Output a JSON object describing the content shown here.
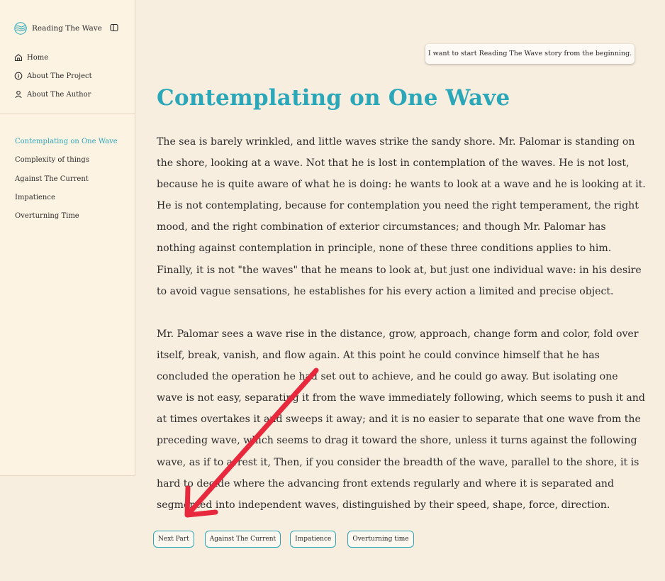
{
  "sidebar": {
    "brand": "Reading The Wave",
    "nav": [
      {
        "label": "Home",
        "icon": "home-icon"
      },
      {
        "label": "About The Project",
        "icon": "info-icon"
      },
      {
        "label": "About The Author",
        "icon": "user-icon"
      }
    ],
    "toc": [
      {
        "label": "Contemplating on One Wave",
        "active": true
      },
      {
        "label": "Complexity of things",
        "active": false
      },
      {
        "label": "Against The Current",
        "active": false
      },
      {
        "label": "Impatience",
        "active": false
      },
      {
        "label": "Overturning Time",
        "active": false
      }
    ]
  },
  "main": {
    "prompt": "I want to start Reading The Wave story from the beginning.",
    "title": "Contemplating on One Wave",
    "paragraphs": [
      "The sea is barely wrinkled, and little waves strike the sandy shore. Mr. Palomar is standing on the shore, looking at a wave. Not that he is lost in contemplation of the waves. He is not lost, because he is quite aware of what he is doing: he wants to look at a wave and he is looking at it. He is not contemplating, because for contemplation you need the right temperament, the right mood, and the right combination of exterior circumstances; and though Mr. Palomar has nothing against contemplation in principle, none of these three conditions applies to him. Finally, it is not \"the waves\" that he means to look at, but just one individual wave: in his desire to avoid vague sensations, he establishes for his every action a limited and precise object.",
      "Mr. Palomar sees a wave rise in the distance, grow, approach, change form and color, fold over itself, break, vanish, and flow again. At this point he could convince himself that he has concluded the operation he had set out to achieve, and he could go away. But isolating one wave is not easy, separating it from the wave immediately following, which seems to push it and at times overtakes it and sweeps it away; and it is no easier to separate that one wave from the preceding wave, which seems to drag it toward the shore, unless it turns against the following wave, as if to arrest it, Then, if you consider the breadth of the wave, parallel to the shore, it is hard to decide where the advancing front extends regularly and where it is separated and segmented into independent waves, distinguished by their speed, shape, force, direction."
    ],
    "buttons": [
      "Next Part",
      "Against The Current",
      "Impatience",
      "Overturning time"
    ]
  },
  "colors": {
    "accent": "#2aa7b8",
    "annotation_arrow": "#e8283c",
    "background": "#f8eee0",
    "sidebar": "#fdf3e3"
  }
}
